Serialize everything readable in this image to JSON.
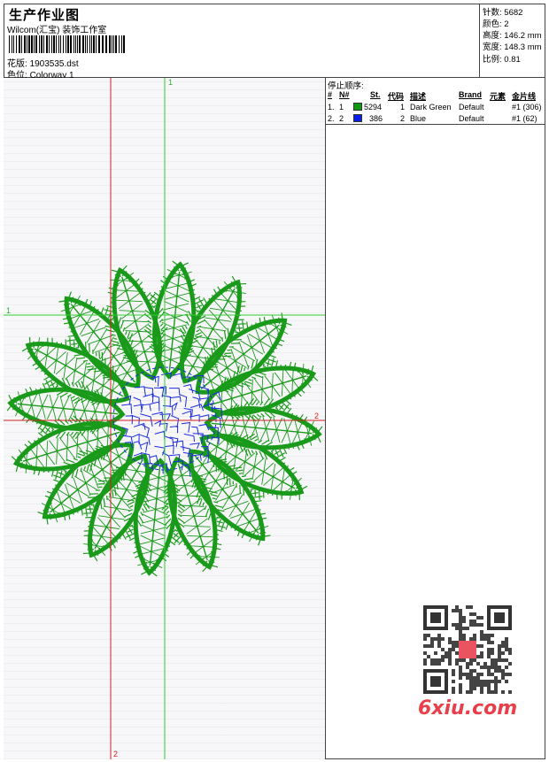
{
  "header": {
    "title": "生产作业图",
    "company": "Wilcom(汇宝) 装饰工作室",
    "design_label": "花版:",
    "design_value": "1903535.dst",
    "colorway_label": "色位:",
    "colorway_value": "Colorway 1"
  },
  "stats": [
    {
      "label": "针数:",
      "value": "5682"
    },
    {
      "label": "颜色:",
      "value": "2"
    },
    {
      "label": "高度:",
      "value": "146.2 mm"
    },
    {
      "label": "宽度:",
      "value": "148.3 mm"
    },
    {
      "label": "比例:",
      "value": "0.81"
    }
  ],
  "stop_sequence": {
    "title": "停止顺序:",
    "columns": [
      "#",
      "N#",
      "St.",
      "代码",
      "描述",
      "Brand",
      "元素",
      "金片线"
    ],
    "rows": [
      {
        "num": "1.",
        "n": "1",
        "color": "#119611",
        "st": "5294",
        "code": "1",
        "desc": "Dark Green",
        "brand": "Default",
        "element": "#1 (306)"
      },
      {
        "num": "2.",
        "n": "2",
        "color": "#0a1ee6",
        "st": "386",
        "code": "2",
        "desc": "Blue",
        "brand": "Default",
        "element": "#1 (62)"
      }
    ]
  },
  "guides": {
    "green_label_top": "1",
    "green_label_left": "1",
    "red_label_right": "2",
    "red_label_bottom": "2"
  },
  "colors": {
    "petal": "#1a9a1a",
    "center": "#1c2bdc",
    "guide_green": "#33cc33",
    "guide_red": "#cc2222"
  },
  "watermark": {
    "text": "6xiu.com",
    "icon": "qr-code-icon"
  }
}
